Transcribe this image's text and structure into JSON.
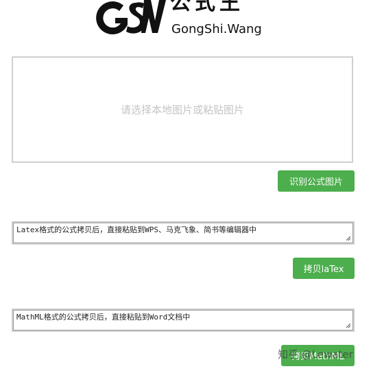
{
  "logo": {
    "text_cn": "公式王",
    "text_en": "GongShi.Wang"
  },
  "upload": {
    "hint": "请选择本地图片或粘贴图片"
  },
  "buttons": {
    "recognize": "识别公式图片",
    "copy_latex": "拷贝laTex",
    "copy_mathml": "拷贝MathML"
  },
  "latex_box": {
    "placeholder": "Latex格式的公式拷贝后，直接粘贴到WPS、马克飞象、简书等编辑器中"
  },
  "mathml_box": {
    "placeholder": "MathML格式的公式拷贝后，直接粘贴到Word文档中"
  },
  "watermark": {
    "text": "知乎 @Lewater"
  },
  "colors": {
    "button_green": "#4cae4c",
    "border_gray": "#cfcfcf"
  }
}
